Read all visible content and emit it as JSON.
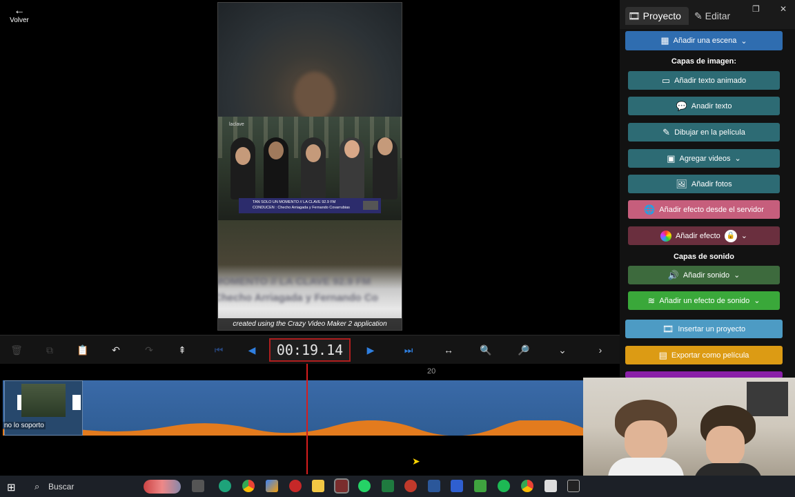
{
  "header": {
    "back_label": "Volver"
  },
  "preview": {
    "watermark": "created using the Crazy Video Maker 2 application",
    "channel_logo": "laclave",
    "lower_third_line1": "TAN SOLO UN MOMENTO // LA CLAVE 92.9 FM",
    "lower_third_line2": "CONDUCEN : Checho Arriagada y Fernando Covarrubias",
    "blurred_line1": "MOMENTO // LA CLAVE 92.9 FM",
    "blurred_line2": "Checho Arriagada y Fernando Co"
  },
  "panel": {
    "tabs": [
      {
        "label": "Proyecto"
      },
      {
        "label": "Editar"
      }
    ],
    "add_scene": "Añadir una escena",
    "image_layers_title": "Capas de imagen:",
    "add_animated_text": "Añadir texto animado",
    "add_text": "Anadir texto",
    "draw": "Dibujar en la película",
    "add_videos": "Agregar videos",
    "add_photos": "Añadir fotos",
    "add_server_effect": "Añadir efecto desde el servidor",
    "add_effect": "Añadir efecto",
    "sound_layers_title": "Capas de sonido",
    "add_sound": "Añadir sonido",
    "add_sound_effect": "Añadir un efecto de sonido",
    "insert_project": "Insertar un proyecto",
    "export_movie": "Exportar como película",
    "accent_colors": {
      "blue": "#2f6db0",
      "teal": "#2d6b74",
      "pink": "#c65e7c",
      "green": "#3aa83a",
      "orange": "#dc9b14",
      "purple": "#8a1fa8"
    }
  },
  "toolbar": {
    "timecode": "00:19.14"
  },
  "timeline": {
    "ruler_mark": "20",
    "clip_label": "no lo soporto"
  },
  "taskbar": {
    "search_placeholder": "Buscar"
  }
}
